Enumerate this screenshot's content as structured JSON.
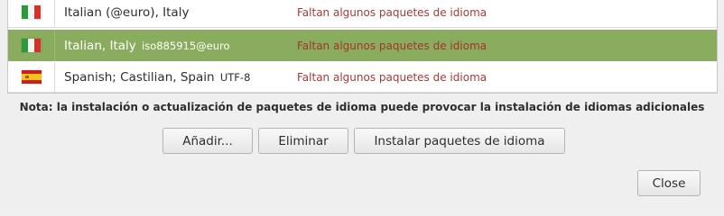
{
  "languages": [
    {
      "flag": "italy-flag",
      "name": "Italian (@euro), Italy",
      "encoding": "",
      "status": "Faltan algunos paquetes de idioma",
      "selected": false
    },
    {
      "flag": "italy-flag",
      "name": "Italian, Italy",
      "encoding": "iso885915@euro",
      "status": "Faltan algunos paquetes de idioma",
      "selected": true
    },
    {
      "flag": "spain-flag",
      "name": "Spanish; Castilian, Spain",
      "encoding": "UTF-8",
      "status": "Faltan algunos paquetes de idioma",
      "selected": false
    }
  ],
  "note": "Nota: la instalación o actualización de paquetes de idioma puede provocar la instalación de idiomas adicionales",
  "buttons": {
    "add": "Añadir...",
    "remove": "Eliminar",
    "install": "Instalar paquetes de idioma",
    "close": "Close"
  },
  "colors": {
    "selected_row": "#8aac5e",
    "status_text": "#a23b3b"
  }
}
